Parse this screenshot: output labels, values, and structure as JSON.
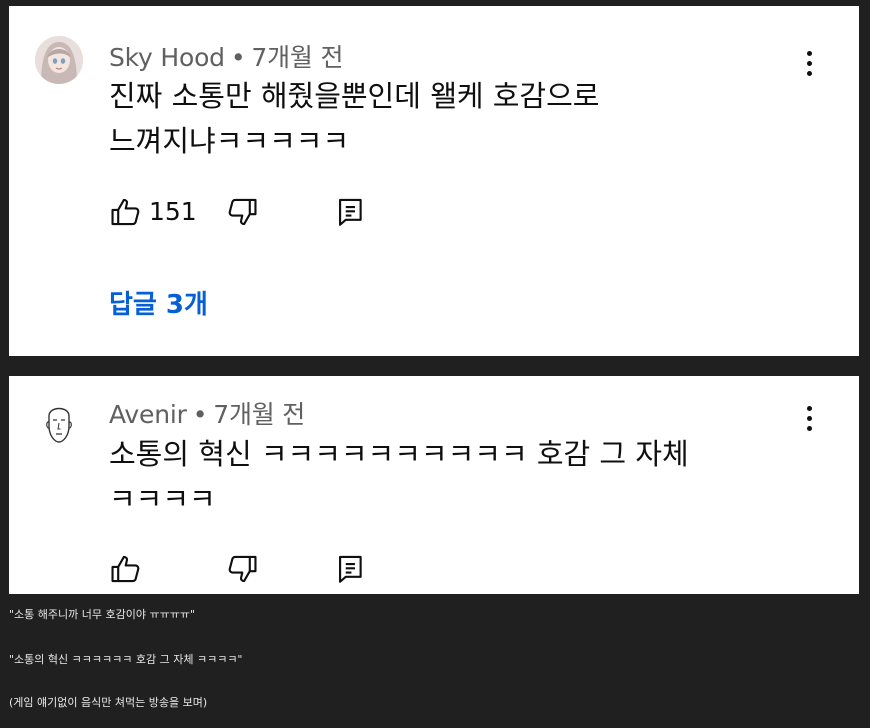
{
  "comments": [
    {
      "author": "Sky Hood",
      "time": "7개월 전",
      "text_line1": "진짜 소통만 해줬을뿐인데 왤케 호감으로",
      "text_line2": "느껴지냐ㅋㅋㅋㅋㅋ",
      "likes": "151",
      "replies_label": "답글 3개",
      "avatar_icon": "anime-girl-avatar-icon"
    },
    {
      "author": "Avenir",
      "time": "7개월 전",
      "text_line1": "소통의 혁신 ㅋㅋㅋㅋㅋㅋㅋㅋㅋㅋ 호감 그 자체",
      "text_line2": "ㅋㅋㅋㅋ",
      "avatar_icon": "bald-head-sketch-avatar-icon"
    }
  ],
  "separator": "•",
  "captions": [
    "\"소통 해주니까 너무 호감이야 ㅠㅠㅠㅠ\"",
    "\"소통의 혁신 ㅋㅋㅋㅋㅋㅋ 호감 그 자체 ㅋㅋㅋㅋ\"",
    "(게임 얘기없이 음식만 쳐먹는 방송을 보며)"
  ],
  "colors": {
    "background": "#202020",
    "card": "#ffffff",
    "meta": "#606060",
    "text": "#0f0f0f",
    "link": "#065fd4"
  }
}
